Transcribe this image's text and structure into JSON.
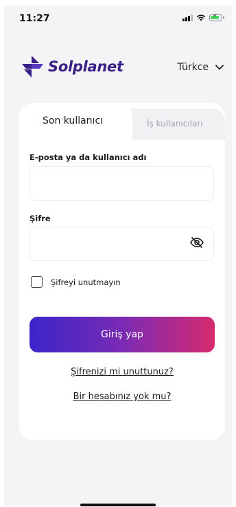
{
  "status_bar": {
    "time": "11:27"
  },
  "header": {
    "brand_name": "Solplanet",
    "language": "Türkce"
  },
  "tabs": [
    {
      "label": "Son kullanıcı",
      "active": true
    },
    {
      "label": "İş kullanıcıları",
      "active": false
    }
  ],
  "form": {
    "email_label": "E-posta ya da kullanıcı adı",
    "email_value": "",
    "password_label": "Şifre",
    "password_value": "",
    "remember_label": "Şifreyi unutmayın",
    "remember_checked": false,
    "login_button": "Giriş yap",
    "forgot_link": "Şifrenizi mi unuttunuz?",
    "signup_link": "Bir hesabınız yok mu?"
  },
  "colors": {
    "brand": "#3a1f86",
    "button_gradient": [
      "#3a25c9",
      "#7a2bb5",
      "#d62a6e"
    ],
    "battery": "#4cd964"
  },
  "icons": [
    "signal-icon",
    "wifi-icon",
    "battery-icon",
    "chevron-down-icon",
    "eye-off-icon",
    "solplanet-logo-icon"
  ]
}
